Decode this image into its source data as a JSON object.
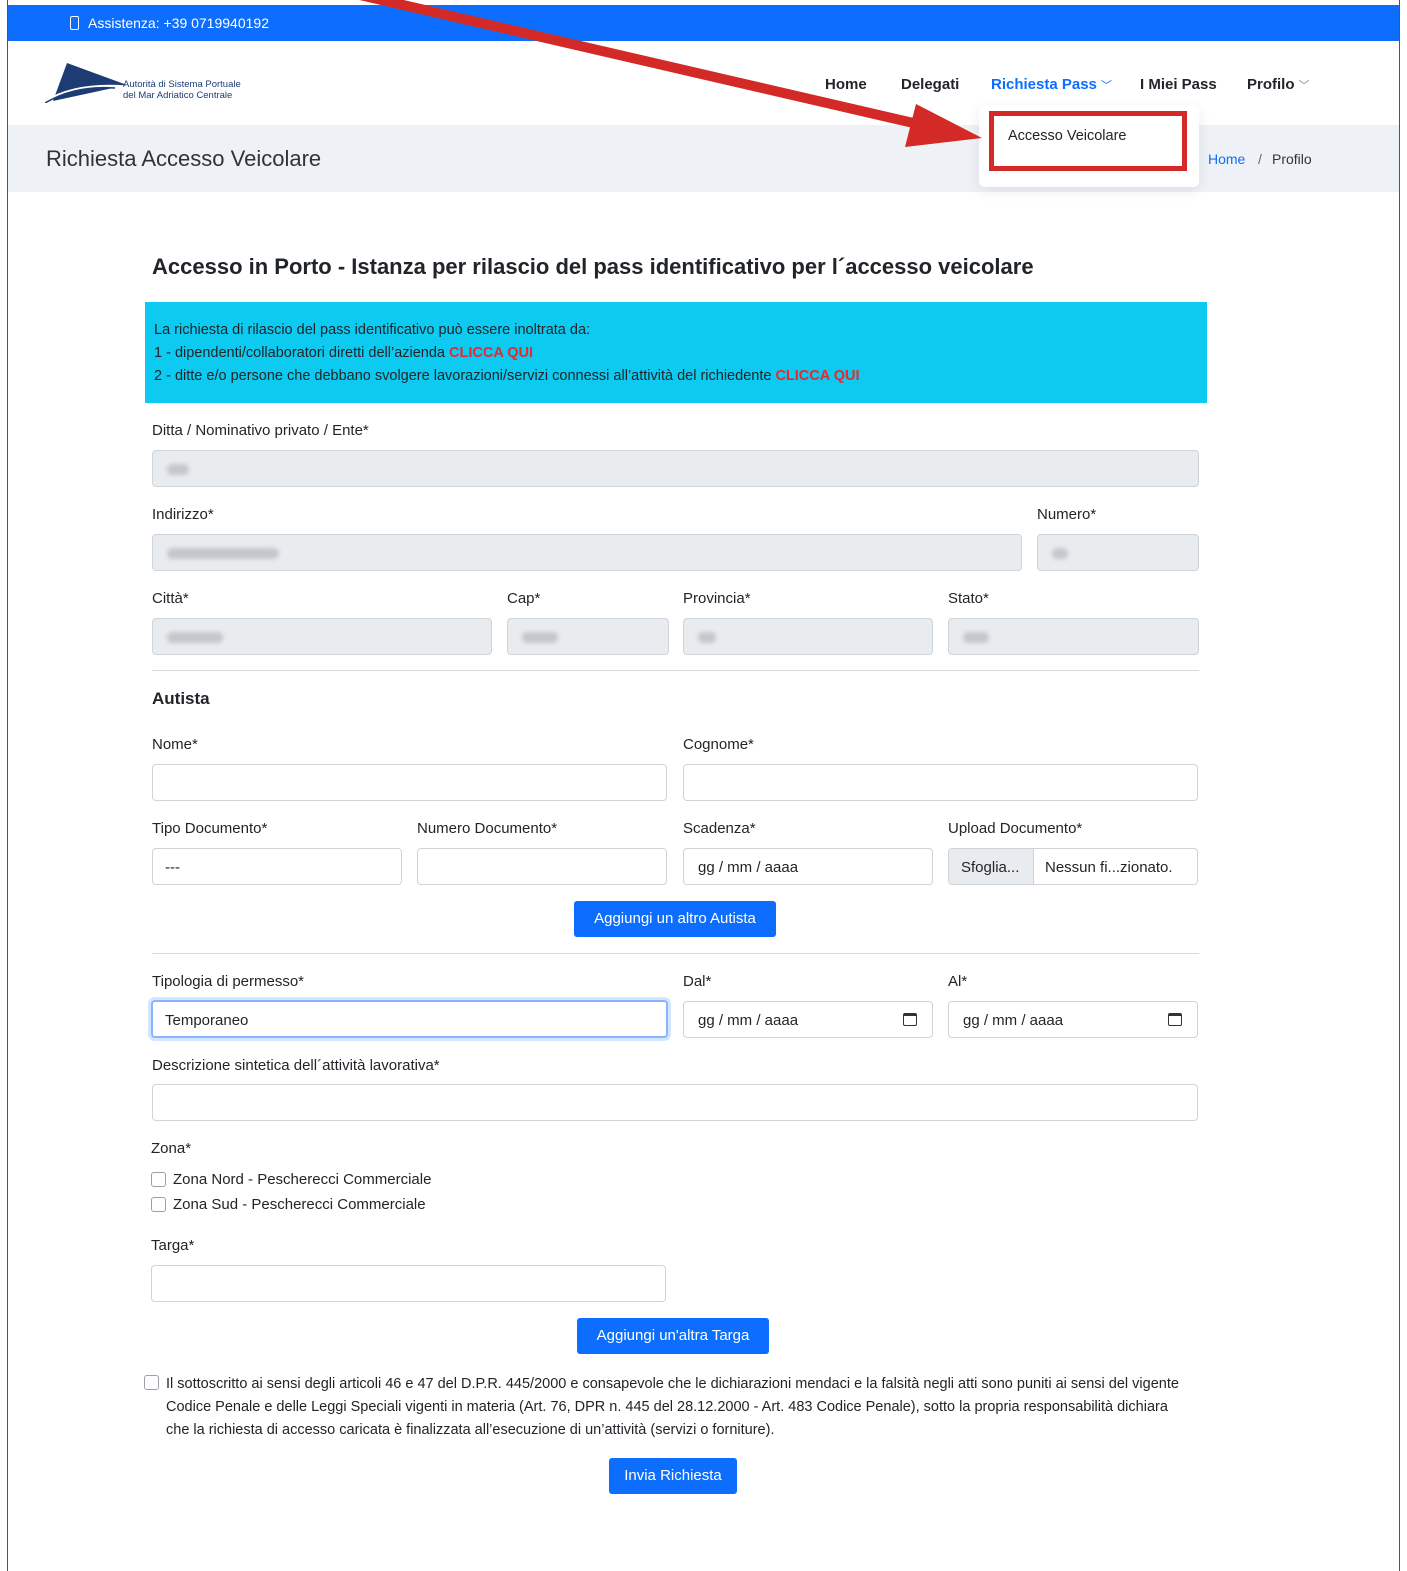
{
  "topbar": {
    "assistance": "Assistenza: +39 0719940192"
  },
  "brand": {
    "line1": "Autorità di Sistema Portuale",
    "line2": "del Mar Adriatico Centrale"
  },
  "nav": {
    "home": "Home",
    "delegati": "Delegati",
    "richiesta_pass": "Richiesta Pass",
    "miei_pass": "I Miei Pass",
    "profilo": "Profilo",
    "dropdown_item": "Accesso Veicolare"
  },
  "subheader": {
    "title": "Richiesta Accesso Veicolare",
    "breadcrumb_home": "Home",
    "breadcrumb_sep": "/",
    "breadcrumb_current": "Profilo"
  },
  "form": {
    "heading": "Accesso in Porto - Istanza per rilascio del pass identificativo per l´accesso veicolare",
    "info": {
      "line1": "La richiesta di rilascio del pass identificativo può essere inoltrata da:",
      "line2_prefix": "1 - dipendenti/collaboratori diretti dell’azienda ",
      "line3_prefix": "2 - ditte e/o persone che debbano svolgere lavorazioni/servizi connessi all’attività del richiedente ",
      "link": "CLICCA QUI"
    },
    "ditta_label": "Ditta / Nominativo privato / Ente*",
    "indirizzo_label": "Indirizzo*",
    "numero_label": "Numero*",
    "citta_label": "Città*",
    "cap_label": "Cap*",
    "provincia_label": "Provincia*",
    "stato_label": "Stato*",
    "autista_heading": "Autista",
    "nome_label": "Nome*",
    "cognome_label": "Cognome*",
    "tipo_doc_label": "Tipo Documento*",
    "tipo_doc_value": "---",
    "numero_doc_label": "Numero Documento*",
    "scadenza_label": "Scadenza*",
    "scadenza_placeholder": "gg / mm / aaaa",
    "upload_label": "Upload Documento*",
    "upload_button": "Sfoglia...",
    "upload_status": "Nessun fi...zionato.",
    "add_autista_button": "Aggiungi un altro Autista",
    "tipologia_label": "Tipologia di permesso*",
    "tipologia_value": "Temporaneo",
    "dal_label": "Dal*",
    "dal_placeholder": "gg / mm / aaaa",
    "al_label": "Al*",
    "al_placeholder": "gg / mm / aaaa",
    "descrizione_label": "Descrizione sintetica dell´attività lavorativa*",
    "zona_label": "Zona*",
    "zona_nord": "Zona Nord - Pescherecci Commerciale",
    "zona_sud": "Zona Sud - Pescherecci Commerciale",
    "targa_label": "Targa*",
    "add_targa_button": "Aggiungi un'altra Targa",
    "declaration": "Il sottoscritto ai sensi degli articoli 46 e 47 del D.P.R. 445/2000 e consapevole che le dichiarazioni mendaci e la falsità negli atti sono puniti ai sensi del vigente Codice Penale e delle Leggi Speciali vigenti in materia (Art. 76, DPR n. 445 del 28.12.2000 - Art. 483 Codice Penale), sotto la propria responsabilità dichiara che la richiesta di accesso caricata è finalizzata all’esecuzione di un’attività (servizi o forniture).",
    "submit_button": "Invia Richiesta"
  },
  "colors": {
    "primary": "#0d6efd",
    "info": "#0dcaf0",
    "annotation": "#d42a27"
  }
}
